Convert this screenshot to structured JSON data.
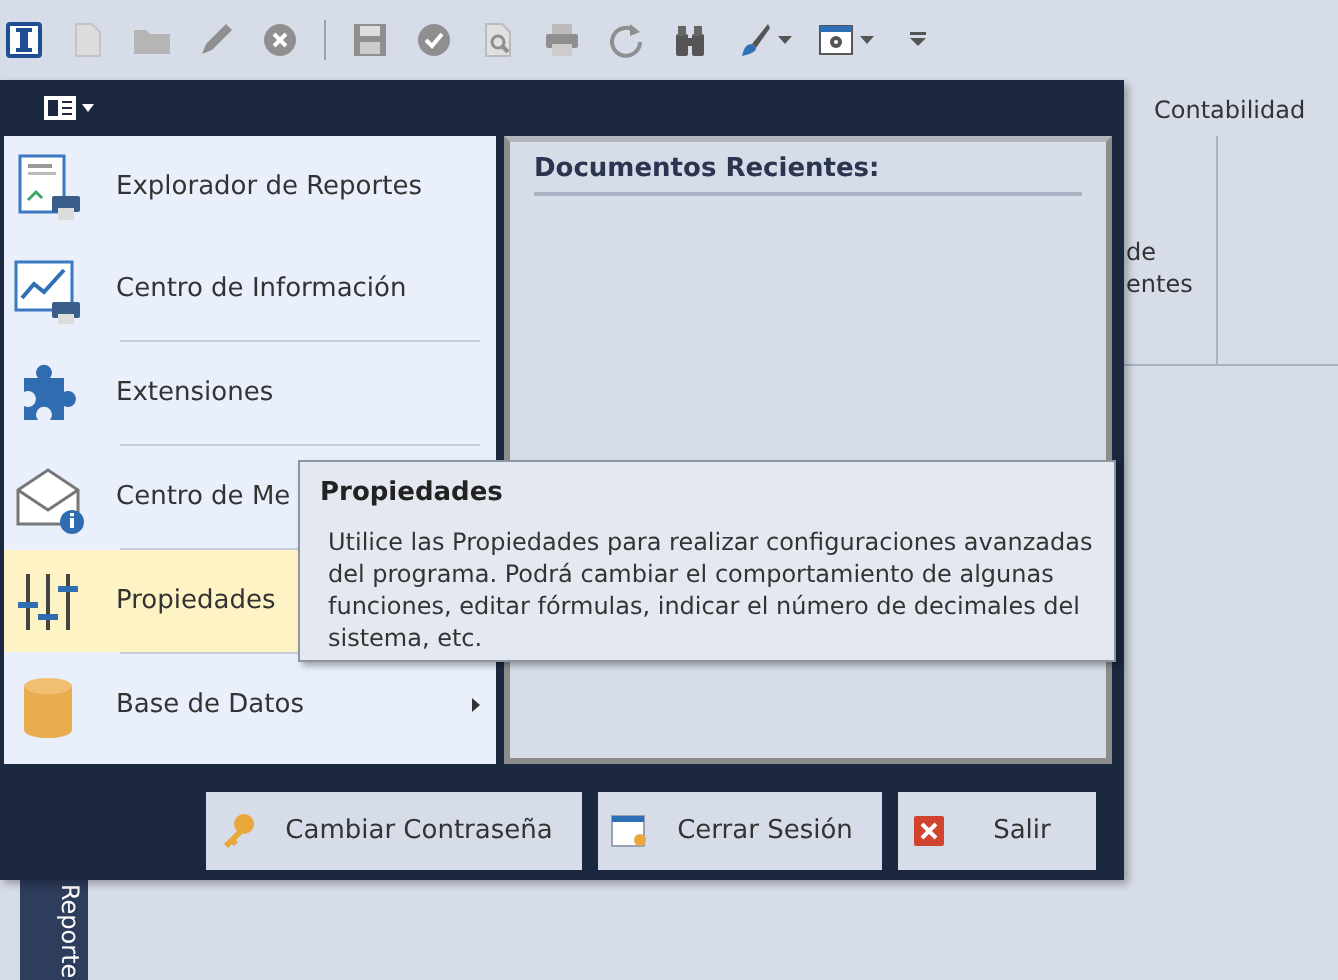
{
  "background": {
    "tab": "Contabilidad",
    "ribbon_text": [
      "de",
      "entes"
    ],
    "side_tab": "Reporte"
  },
  "menu": {
    "items": [
      {
        "kind": "report",
        "label": "Explorador de Reportes",
        "selected": false,
        "separator": false,
        "submenu": false
      },
      {
        "kind": "chart",
        "label": "Centro de Información",
        "selected": false,
        "separator": false,
        "submenu": false
      },
      {
        "kind": "puzzle",
        "label": "Extensiones",
        "selected": false,
        "separator": true,
        "submenu": false
      },
      {
        "kind": "mail",
        "label": "Centro de Me",
        "selected": false,
        "separator": true,
        "submenu": false
      },
      {
        "kind": "sliders",
        "label": "Propiedades",
        "selected": true,
        "separator": true,
        "submenu": false
      },
      {
        "kind": "database",
        "label": "Base de Datos",
        "selected": false,
        "separator": true,
        "submenu": true
      }
    ],
    "recent_title": "Documentos Recientes:",
    "buttons": [
      {
        "kind": "key",
        "label": "Cambiar Contraseña"
      },
      {
        "kind": "logout",
        "label": "Cerrar Sesión"
      },
      {
        "kind": "exit",
        "label": "Salir"
      }
    ]
  },
  "tooltip": {
    "title": "Propiedades",
    "text": "Utilice las Propiedades para realizar configuraciones avanzadas del programa. Podrá cambiar el comportamiento de algunas funciones, editar fórmulas, indicar el número de decimales del sistema, etc."
  }
}
